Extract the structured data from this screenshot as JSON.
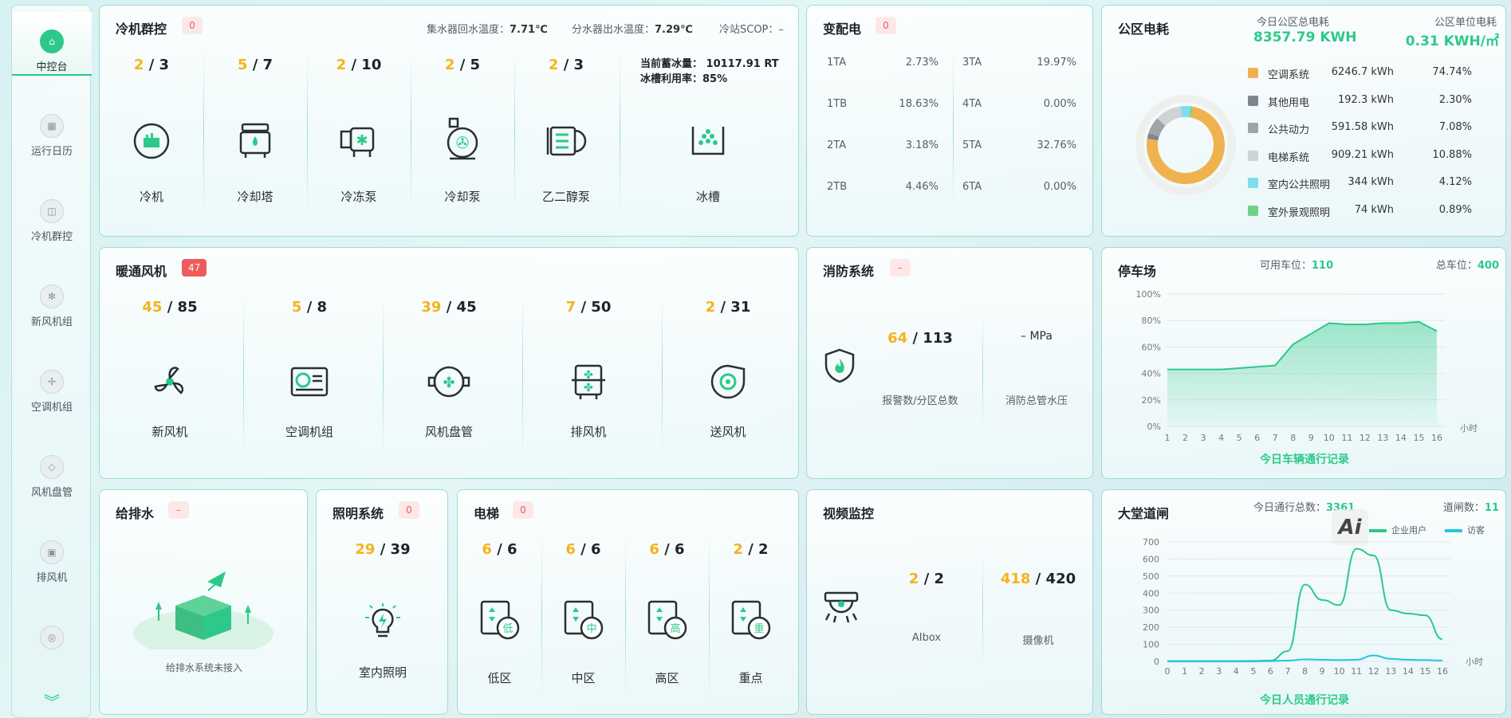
{
  "sidebar": {
    "items": [
      {
        "label": "中控台",
        "icon": "dashboard-icon"
      },
      {
        "label": "运行日历",
        "icon": "calendar-icon"
      },
      {
        "label": "冷机群控",
        "icon": "chiller-icon"
      },
      {
        "label": "新风机组",
        "icon": "fan-icon"
      },
      {
        "label": "空调机组",
        "icon": "ac-icon"
      },
      {
        "label": "风机盘管",
        "icon": "coil-icon"
      },
      {
        "label": "排风机",
        "icon": "exhaust-icon"
      },
      {
        "label": "",
        "icon": "more-icon"
      }
    ],
    "expand": "︾"
  },
  "chiller": {
    "title": "冷机群控",
    "badge": "0",
    "return_temp_label": "集水器回水温度：",
    "return_temp": "7.71℃",
    "supply_temp_label": "分水器出水温度：",
    "supply_temp": "7.29℃",
    "scop_label": "冷站SCOP：",
    "scop": "–",
    "ice_label": "当前蓄冰量：",
    "ice_value": "10117.91 RT",
    "ice_rate_label": "冰槽利用率：",
    "ice_rate": "85%",
    "items": [
      {
        "a": "2",
        "b": " / 3",
        "label": "冷机"
      },
      {
        "a": "5",
        "b": " / 7",
        "label": "冷却塔"
      },
      {
        "a": "2",
        "b": " / 10",
        "label": "冷冻泵"
      },
      {
        "a": "2",
        "b": " / 5",
        "label": "冷却泵"
      },
      {
        "a": "2",
        "b": " / 3",
        "label": "乙二醇泵"
      }
    ],
    "ice_tank_label": "冰槽"
  },
  "power": {
    "title": "变配电",
    "badge": "0",
    "left": [
      {
        "name": "1TA",
        "value": "2.73%"
      },
      {
        "name": "1TB",
        "value": "18.63%"
      },
      {
        "name": "2TA",
        "value": "3.18%"
      },
      {
        "name": "2TB",
        "value": "4.46%"
      }
    ],
    "right": [
      {
        "name": "3TA",
        "value": "19.97%"
      },
      {
        "name": "4TA",
        "value": "0.00%"
      },
      {
        "name": "5TA",
        "value": "32.76%"
      },
      {
        "name": "6TA",
        "value": "0.00%"
      }
    ]
  },
  "energy": {
    "title": "公区电耗",
    "today_label": "今日公区总电耗",
    "today_value": "8357.79 KWH",
    "unit_label": "公区单位电耗",
    "unit_value": "0.31 KWH/㎡",
    "items": [
      {
        "name": "空调系统",
        "kwh": "6246.7 kWh",
        "pct": "74.74%",
        "color": "#efb24f",
        "frac": 0.7474
      },
      {
        "name": "其他用电",
        "kwh": "192.3 kWh",
        "pct": "2.30%",
        "color": "#7d8790",
        "frac": 0.023
      },
      {
        "name": "公共动力",
        "kwh": "591.58 kWh",
        "pct": "7.08%",
        "color": "#9da4aa",
        "frac": 0.0708
      },
      {
        "name": "电梯系统",
        "kwh": "909.21 kWh",
        "pct": "10.88%",
        "color": "#cfd3d6",
        "frac": 0.1088
      },
      {
        "name": "室内公共照明",
        "kwh": "344 kWh",
        "pct": "4.12%",
        "color": "#7fdcea",
        "frac": 0.0412
      },
      {
        "name": "室外景观照明",
        "kwh": "74 kWh",
        "pct": "0.89%",
        "color": "#6fd08a",
        "frac": 0.0089
      }
    ]
  },
  "hvac": {
    "title": "暖通风机",
    "badge": "47",
    "items": [
      {
        "a": "45",
        "b": " / 85",
        "label": "新风机"
      },
      {
        "a": "5",
        "b": " / 8",
        "label": "空调机组"
      },
      {
        "a": "39",
        "b": " / 45",
        "label": "风机盘管"
      },
      {
        "a": "7",
        "b": " / 50",
        "label": "排风机"
      },
      {
        "a": "2",
        "b": " / 31",
        "label": "送风机"
      }
    ]
  },
  "fire": {
    "title": "消防系统",
    "badge": "–",
    "a": "64",
    "b": " / 113",
    "count_label": "报警数/分区总数",
    "pressure": "– MPa",
    "pressure_label": "消防总管水压"
  },
  "parking": {
    "title": "停车场",
    "avail_label": "可用车位：",
    "avail": "110",
    "total_label": "总车位：",
    "total": "400",
    "unit": "小时",
    "caption": "今日车辆通行记录"
  },
  "water": {
    "title": "给排水",
    "badge": "–",
    "note": "给排水系统未接入"
  },
  "lighting": {
    "title": "照明系统",
    "badge": "0",
    "a": "29",
    "b": " / 39",
    "label": "室内照明"
  },
  "elevator": {
    "title": "电梯",
    "badge": "0",
    "items": [
      {
        "a": "6",
        "b": " / 6",
        "label": "低区",
        "tag": "低"
      },
      {
        "a": "6",
        "b": " / 6",
        "label": "中区",
        "tag": "中"
      },
      {
        "a": "6",
        "b": " / 6",
        "label": "高区",
        "tag": "高"
      },
      {
        "a": "2",
        "b": " / 2",
        "label": "重点",
        "tag": "重"
      }
    ]
  },
  "video": {
    "title": "视频监控",
    "aibox_a": "2",
    "aibox_b": " / 2",
    "aibox_label": "AIbox",
    "cam_a": "418",
    "cam_b": " / 420",
    "cam_label": "摄像机"
  },
  "lobby": {
    "title": "大堂道闸",
    "total_label": "今日通行总数：",
    "total": "3361",
    "gate_label": "道闸数：",
    "gate": "11",
    "legend_a": "企业用户",
    "legend_b": "访客",
    "unit": "小时",
    "caption": "今日人员通行记录",
    "watermark": "Ai"
  },
  "chart_data": [
    {
      "type": "area",
      "title": "今日车辆通行记录",
      "xlabel": "小时",
      "x": [
        1,
        2,
        3,
        4,
        5,
        6,
        7,
        8,
        9,
        10,
        11,
        12,
        13,
        14,
        15,
        16
      ],
      "series": [
        {
          "values": [
            43,
            43,
            43,
            43,
            44,
            45,
            46,
            62,
            70,
            78,
            77,
            77,
            78,
            78,
            79,
            72
          ]
        }
      ],
      "ylim": [
        0,
        100
      ],
      "yticks": [
        "0%",
        "20%",
        "40%",
        "60%",
        "80%",
        "100%"
      ]
    },
    {
      "type": "line",
      "title": "今日人员通行记录",
      "xlabel": "小时",
      "x": [
        0,
        1,
        2,
        3,
        4,
        5,
        6,
        7,
        8,
        9,
        10,
        11,
        12,
        13,
        14,
        15,
        16
      ],
      "series": [
        {
          "name": "企业用户",
          "values": [
            2,
            2,
            2,
            2,
            2,
            3,
            5,
            60,
            450,
            360,
            330,
            660,
            620,
            300,
            280,
            270,
            130
          ]
        },
        {
          "name": "访客",
          "values": [
            0,
            0,
            0,
            0,
            0,
            0,
            2,
            5,
            12,
            10,
            8,
            10,
            35,
            15,
            10,
            8,
            5
          ]
        }
      ],
      "ylim": [
        0,
        700
      ],
      "yticks": [
        0,
        100,
        200,
        300,
        400,
        500,
        600,
        700
      ]
    }
  ]
}
